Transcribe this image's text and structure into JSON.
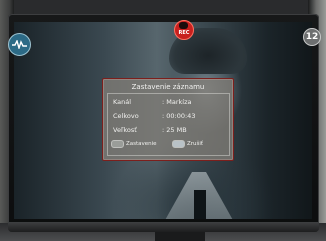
{
  "overlay": {
    "rec_label": "REC",
    "rec_icon": "record-icon",
    "left_icon": "waveform-icon",
    "channel_badge": "12"
  },
  "dialog": {
    "title": "Zastavenie záznamu",
    "rows": [
      {
        "label": "Kanál",
        "value": ": Markíza"
      },
      {
        "label": "Celkovo",
        "value": ": 00:00:43"
      },
      {
        "label": "Veľkosť",
        "value": ": 25 MB"
      }
    ],
    "buttons": [
      {
        "key": "OK",
        "label": "Zastavenie"
      },
      {
        "key": "EXIT",
        "label": "Zrušiť"
      }
    ]
  },
  "colors": {
    "dialog_border": "#7c1f1c",
    "rec": "#c8201e"
  }
}
